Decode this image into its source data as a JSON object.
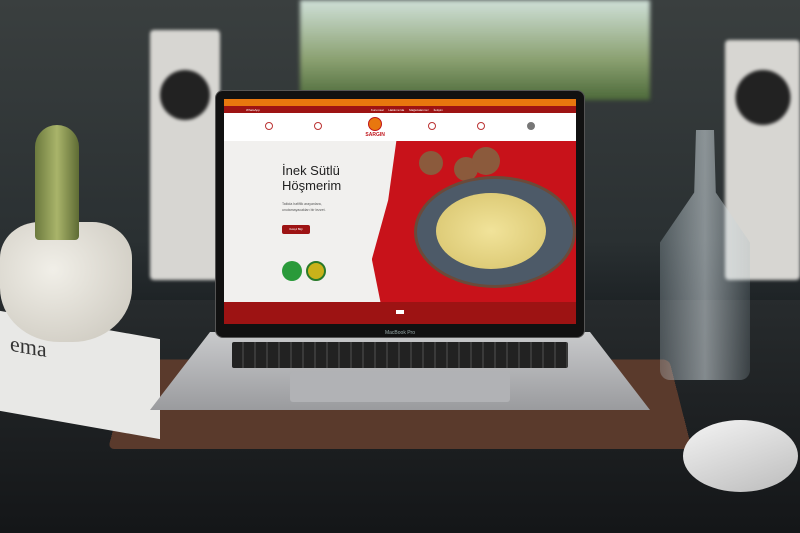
{
  "laptop": {
    "model": "MacBook Pro"
  },
  "website": {
    "announcement": "",
    "nav": {
      "whatsapp": "WhatsApp",
      "links": [
        "Kurumsal",
        "Hakkımızda",
        "Mağazalarımız",
        "İletişim"
      ]
    },
    "logo": "SARGIN",
    "hero": {
      "title_line1": "İnek Sütlü",
      "title_line2": "Höşmerim",
      "subtitle": "Tatlıda hafiflik arayanlara, unutamayacakları bir lezzet.",
      "button": "Detaylı Bilgi"
    },
    "colors": {
      "primary": "#9d1313",
      "accent": "#e8770e"
    }
  },
  "newspaper": {
    "text": "ema"
  }
}
